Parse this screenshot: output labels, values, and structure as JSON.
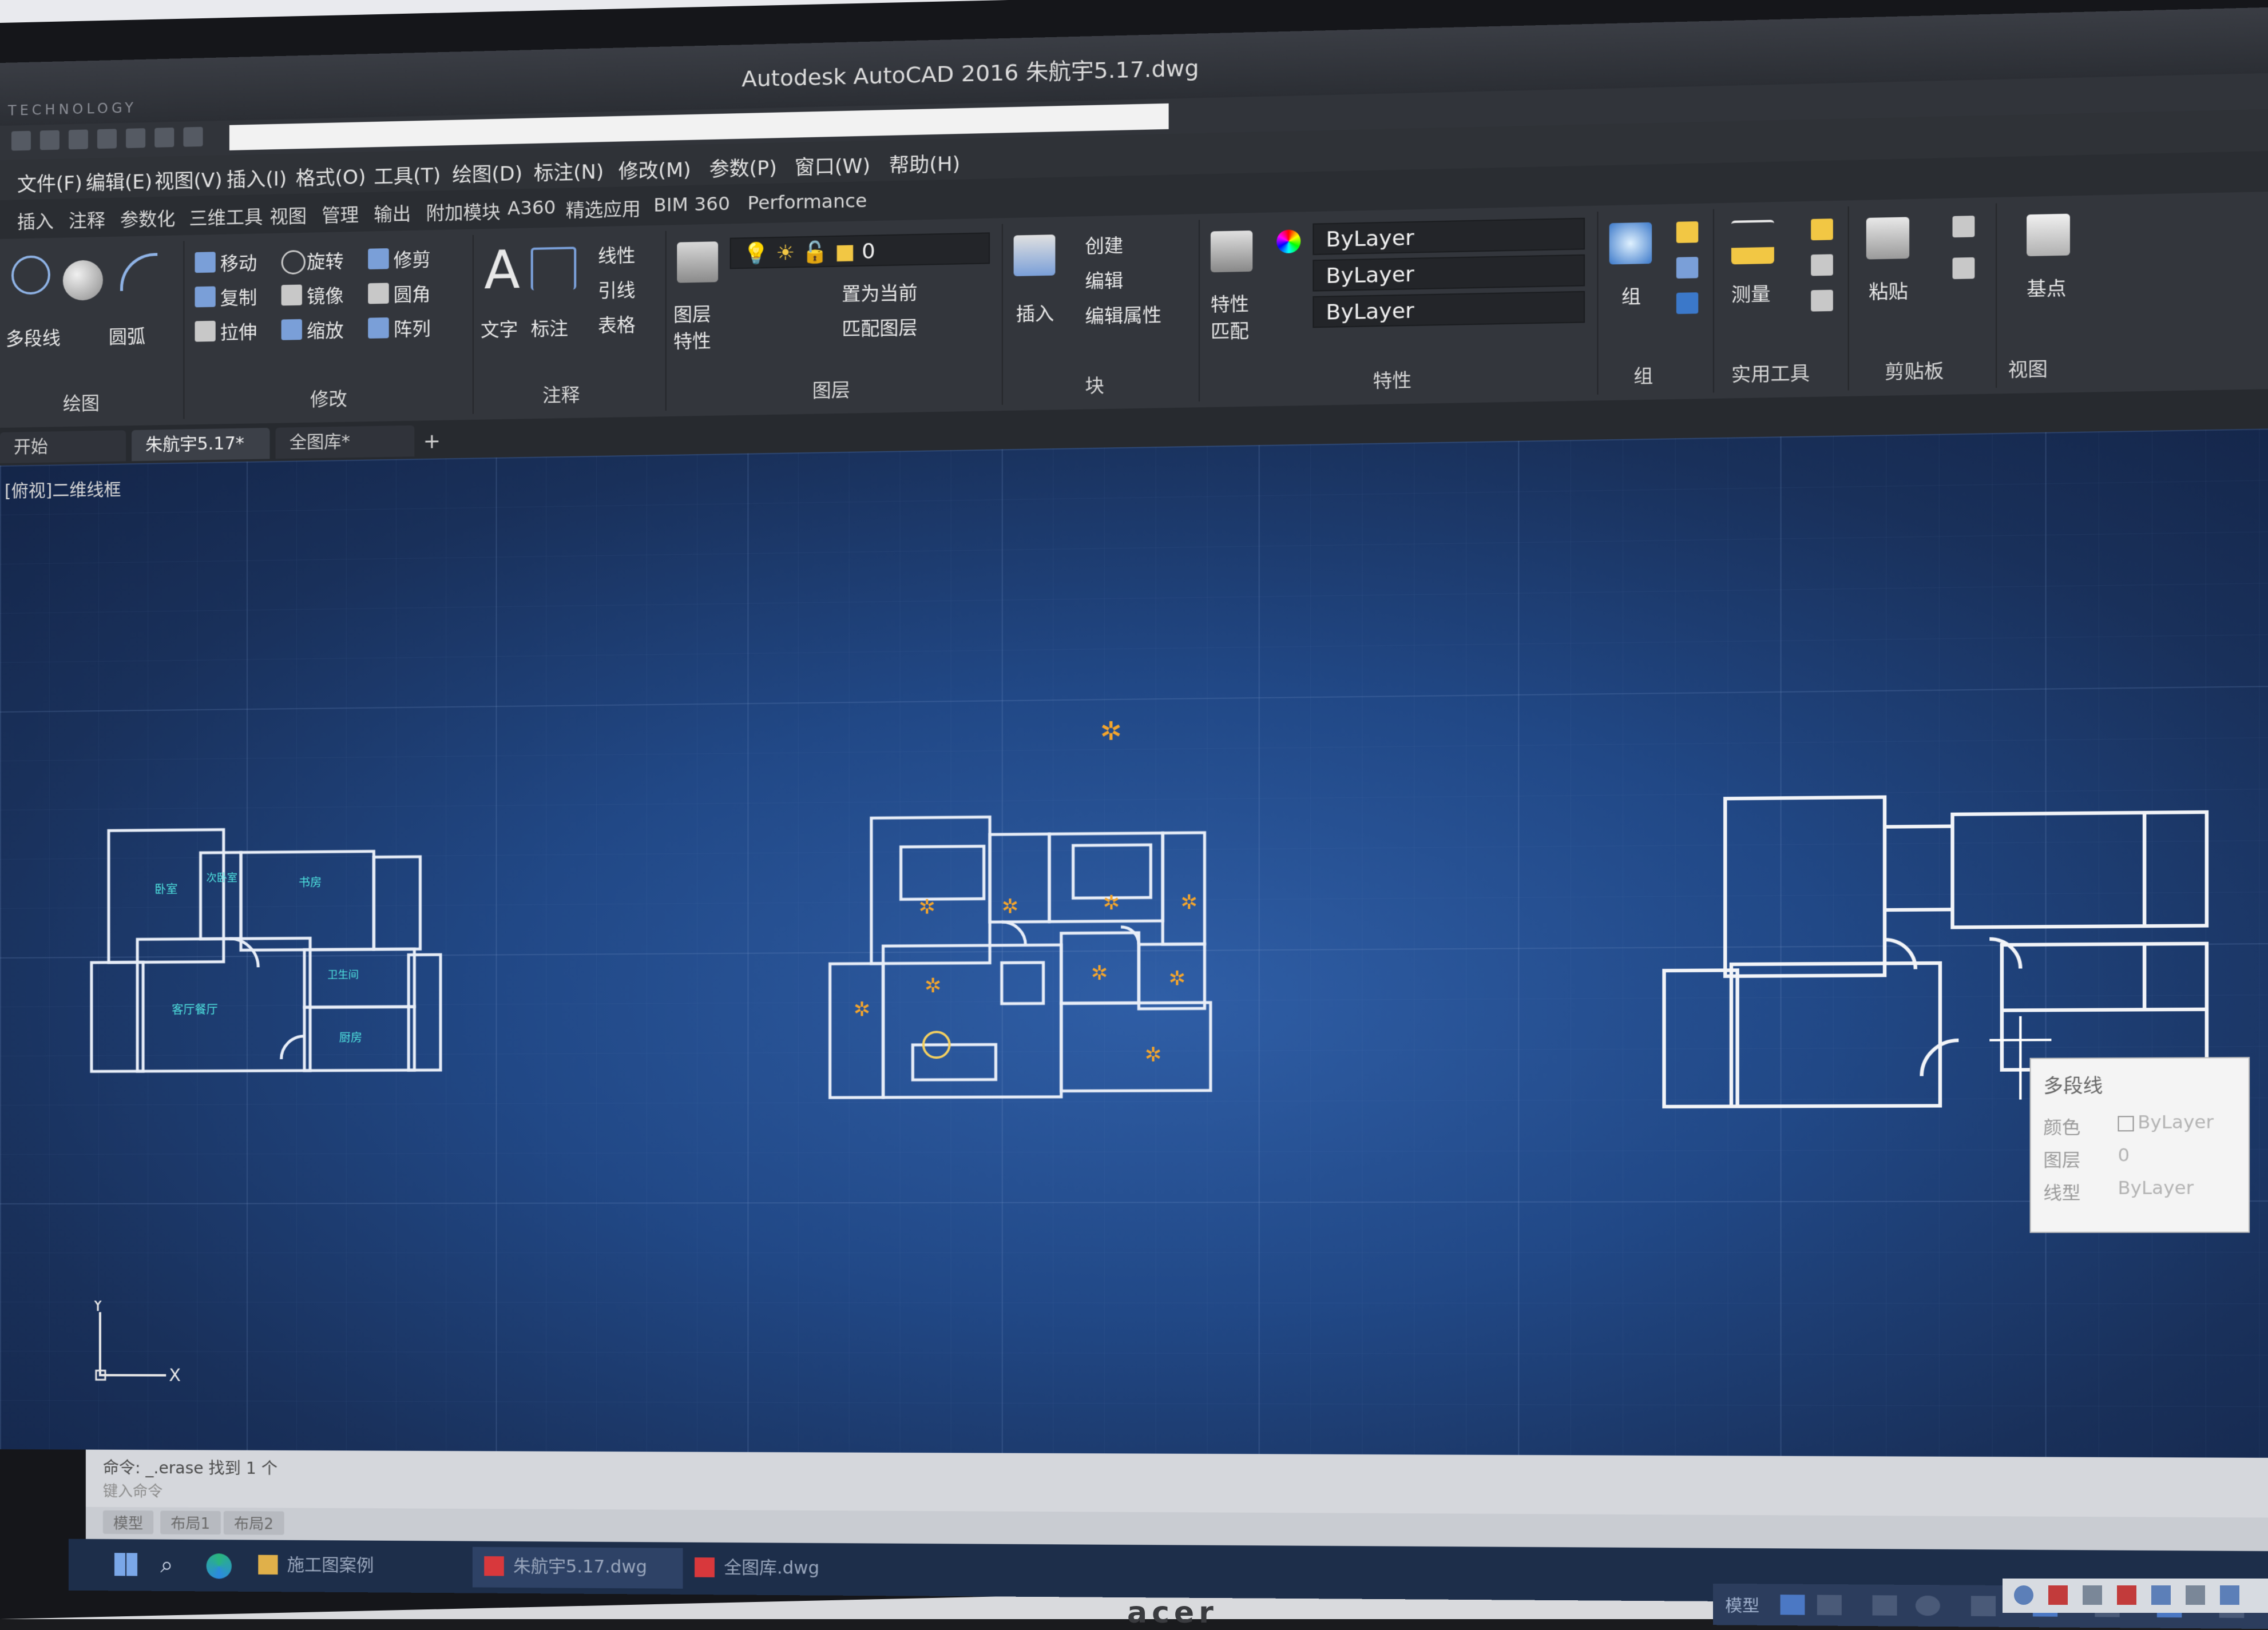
{
  "window": {
    "title": "Autodesk AutoCAD 2016    朱航宇5.17.dwg",
    "brand": "TECHNOLOGY"
  },
  "menu": {
    "items": [
      "文件(F)",
      "编辑(E)",
      "视图(V)",
      "插入(I)",
      "格式(O)",
      "工具(T)",
      "绘图(D)",
      "标注(N)",
      "修改(M)",
      "参数(P)",
      "窗口(W)",
      "帮助(H)"
    ]
  },
  "ribbon_tabs": {
    "items": [
      "插入",
      "注释",
      "参数化",
      "三维工具",
      "视图",
      "管理",
      "输出",
      "附加模块",
      "A360",
      "精选应用",
      "BIM 360",
      "Performance"
    ]
  },
  "ribbon": {
    "draw": {
      "label": "绘图",
      "polyline": "多段线",
      "arc": "圆弧"
    },
    "modify": {
      "label": "修改",
      "move": "移动",
      "rotate": "旋转",
      "trim": "修剪",
      "copy": "复制",
      "mirror": "镜像",
      "fillet": "圆角",
      "stretch": "拉伸",
      "scale": "缩放",
      "array": "阵列"
    },
    "annotation": {
      "label": "注释",
      "text": "文字",
      "dimension": "标注",
      "linear": "线性",
      "leader": "引线",
      "table": "表格"
    },
    "layers": {
      "label": "图层",
      "properties": "图层\n特性",
      "current_layer": "0",
      "make_current": "置为当前",
      "match_layer": "匹配图层"
    },
    "block": {
      "label": "块",
      "insert": "插入",
      "create": "创建",
      "edit": "编辑",
      "edit_attr": "编辑属性"
    },
    "properties": {
      "label": "特性",
      "match": "特性\n匹配",
      "color": "ByLayer",
      "linetype": "ByLayer",
      "lineweight": "ByLayer"
    },
    "groups": {
      "label": "组",
      "group": "组"
    },
    "utilities": {
      "label": "实用工具",
      "measure": "测量"
    },
    "clipboard": {
      "label": "剪贴板",
      "paste": "粘贴"
    },
    "view": {
      "label": "视图",
      "base": "基点"
    }
  },
  "doc_tabs": {
    "items": [
      "开始",
      "朱航宇5.17*",
      "全图库*"
    ]
  },
  "canvas": {
    "view_label": "[俯视]二维线框",
    "rooms_left": [
      "卧室",
      "次卧室",
      "书房",
      "客厅餐厅",
      "卫生间",
      "厨房"
    ],
    "ucs_y": "Y",
    "ucs_x": "X"
  },
  "tooltip": {
    "title": "多段线",
    "rows": [
      {
        "key": "颜色",
        "value": "ByLayer"
      },
      {
        "key": "图层",
        "value": "0"
      },
      {
        "key": "线型",
        "value": "ByLayer"
      }
    ]
  },
  "command": {
    "history": "命令: _.erase 找到 1 个",
    "prompt": "键入命令"
  },
  "layout_tabs": {
    "items": [
      "模型",
      "布局1",
      "布局2"
    ]
  },
  "taskbar": {
    "items": [
      "施工图案例",
      "朱航宇5.17.dwg",
      "全图库.dwg"
    ]
  },
  "statusbar": {
    "model": "模型"
  },
  "monitor_logo": "acer"
}
